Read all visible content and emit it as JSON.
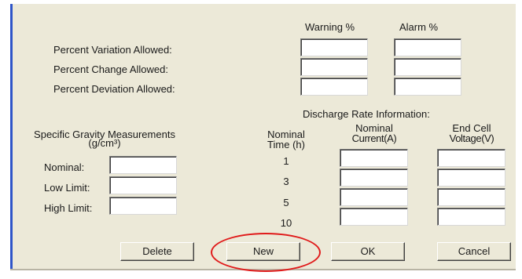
{
  "thresholds": {
    "warning_header": "Warning %",
    "alarm_header": "Alarm %",
    "rows": [
      {
        "label": "Percent Variation Allowed:",
        "warning": "",
        "alarm": ""
      },
      {
        "label": "Percent Change Allowed:",
        "warning": "",
        "alarm": ""
      },
      {
        "label": "Percent Deviation Allowed:",
        "warning": "",
        "alarm": ""
      }
    ]
  },
  "gravity": {
    "title_line1": "Specific Gravity Measurements",
    "title_line2": "(g/cm³)",
    "rows": [
      {
        "label": "Nominal:",
        "value": ""
      },
      {
        "label": "Low Limit:",
        "value": ""
      },
      {
        "label": "High Limit:",
        "value": ""
      }
    ]
  },
  "discharge": {
    "title": "Discharge Rate Information:",
    "col_time_line1": "Nominal",
    "col_time_line2": "Time (h)",
    "col_current_line1": "Nominal",
    "col_current_line2": "Current(A)",
    "col_voltage_line1": "End Cell",
    "col_voltage_line2": "Voltage(V)",
    "rows": [
      {
        "time": "1",
        "current": "",
        "voltage": ""
      },
      {
        "time": "3",
        "current": "",
        "voltage": ""
      },
      {
        "time": "5",
        "current": "",
        "voltage": ""
      },
      {
        "time": "10",
        "current": "",
        "voltage": ""
      }
    ]
  },
  "buttons": {
    "delete": "Delete",
    "new": "New",
    "ok": "OK",
    "cancel": "Cancel"
  },
  "colors": {
    "panel_bg": "#ece9d8",
    "left_border": "#2f55c8",
    "highlight_circle": "#e01b1b"
  }
}
